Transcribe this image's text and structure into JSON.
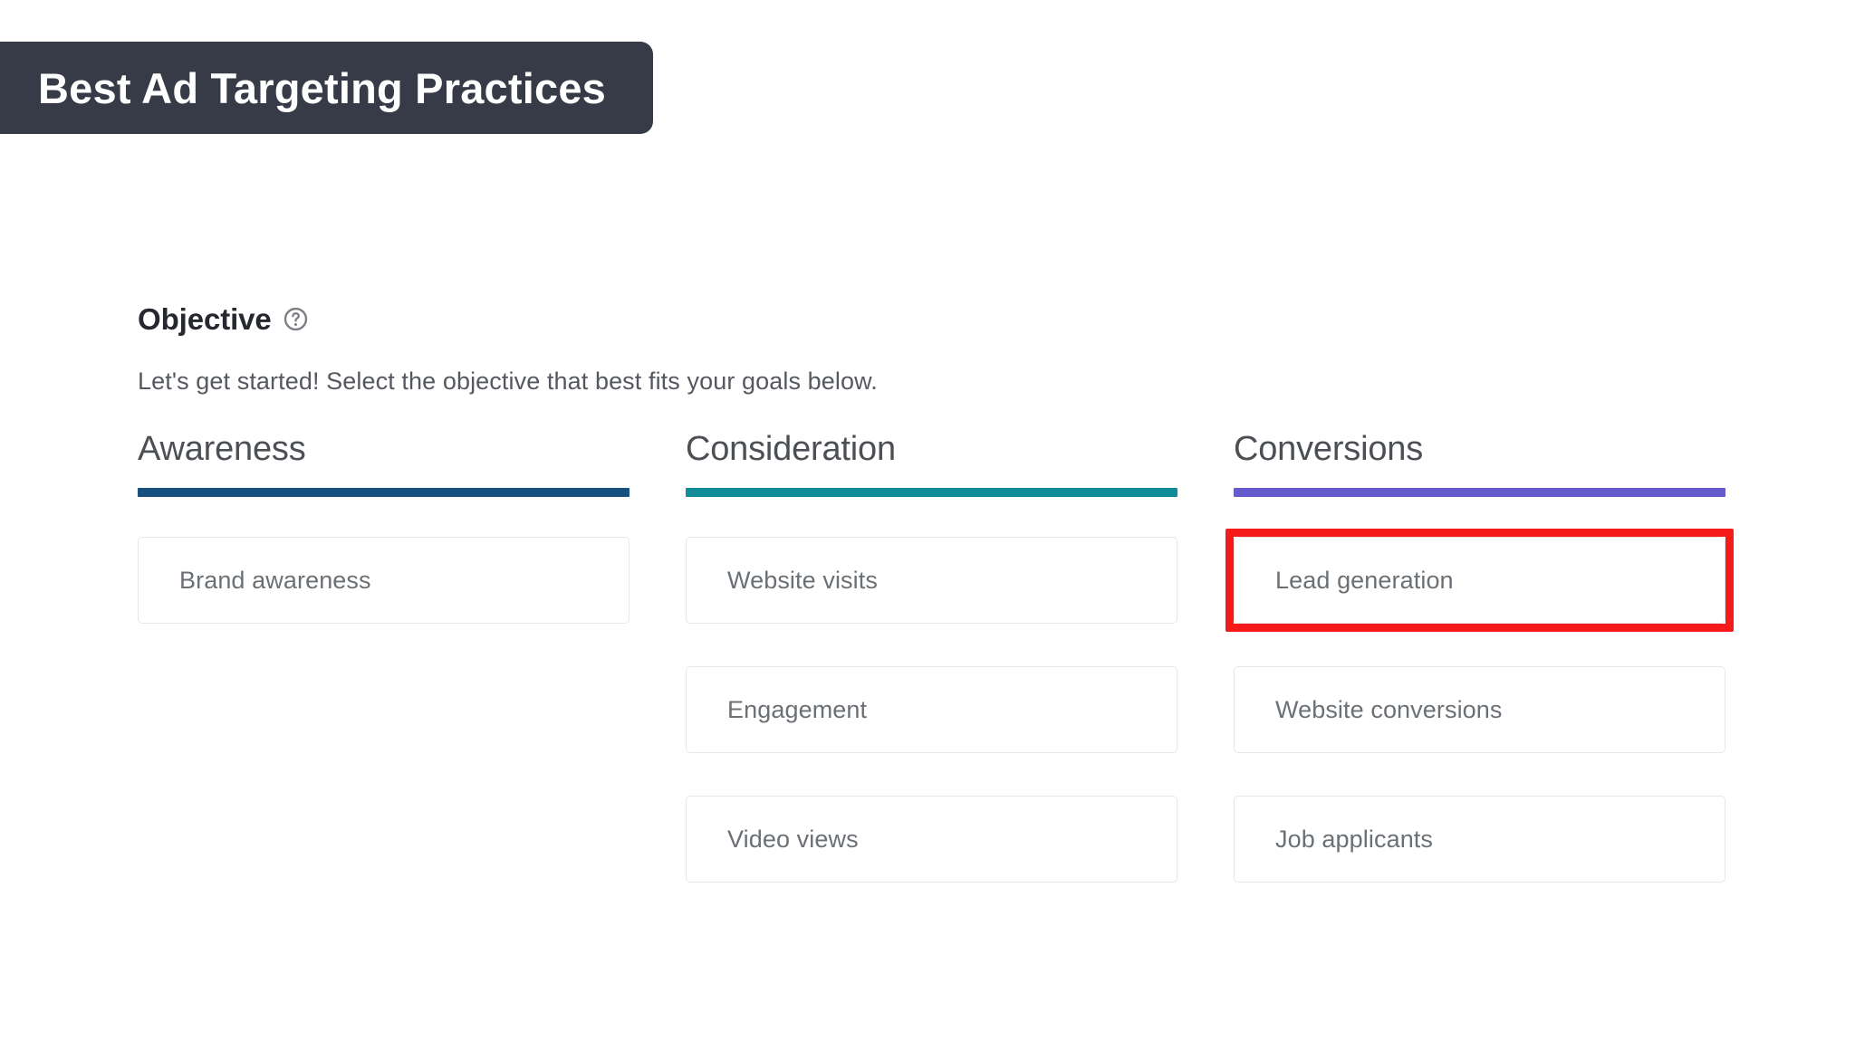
{
  "banner": {
    "title": "Best Ad Targeting Practices",
    "background_color": "#363b47",
    "text_color": "#ffffff"
  },
  "objective_section": {
    "heading": "Objective",
    "help_icon": "help-circle-icon",
    "subtitle": "Let's get started! Select the objective that best fits your goals below."
  },
  "columns": [
    {
      "title": "Awareness",
      "rule_color": "#14517f",
      "border_style": "teal",
      "options": [
        {
          "label": "Brand awareness",
          "highlighted": false
        }
      ]
    },
    {
      "title": "Consideration",
      "rule_color": "#108d99",
      "border_style": "teal",
      "options": [
        {
          "label": "Website visits",
          "highlighted": false
        },
        {
          "label": "Engagement",
          "highlighted": false
        },
        {
          "label": "Video views",
          "highlighted": false
        }
      ]
    },
    {
      "title": "Conversions",
      "rule_color": "#655bcc",
      "border_style": "neutral",
      "options": [
        {
          "label": "Lead generation",
          "highlighted": true
        },
        {
          "label": "Website conversions",
          "highlighted": false
        },
        {
          "label": "Job applicants",
          "highlighted": false
        }
      ]
    }
  ],
  "annotation": {
    "highlight_color": "#f51b1b",
    "highlight_target": "Lead generation"
  }
}
